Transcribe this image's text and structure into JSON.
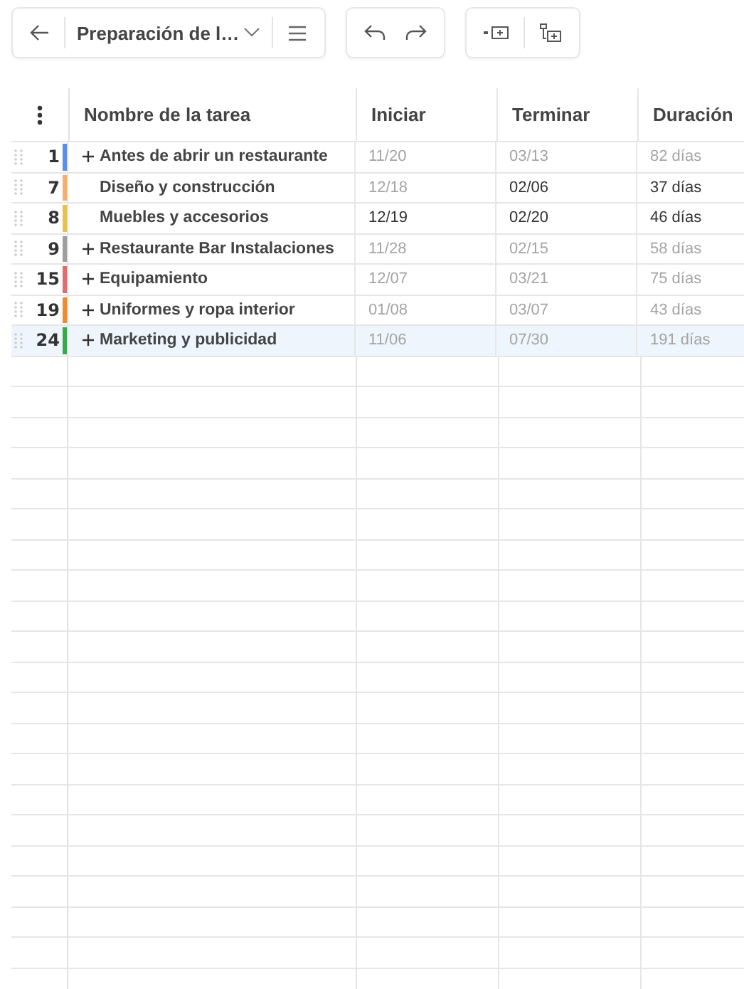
{
  "toolbar": {
    "title": "Preparación de l…"
  },
  "table": {
    "columns": [
      "Nombre de la tarea",
      "Iniciar",
      "Terminar",
      "Duración"
    ],
    "rows": [
      {
        "id": "1",
        "color": "#5b8def",
        "selected": false,
        "cells": [
          {
            "text": "Antes de abrir un restaurante",
            "expandable": true
          },
          {
            "text": "11/20",
            "muted": true
          },
          {
            "text": "03/13",
            "muted": true
          },
          {
            "text": "82 días",
            "muted": true
          }
        ]
      },
      {
        "id": "7",
        "color": "#f0b070",
        "selected": false,
        "cells": [
          {
            "text": "Diseño y construcción",
            "expandable": false
          },
          {
            "text": "12/18",
            "muted": true
          },
          {
            "text": "02/06",
            "muted": false
          },
          {
            "text": "37 días",
            "muted": false
          }
        ]
      },
      {
        "id": "8",
        "color": "#e8c050",
        "selected": false,
        "cells": [
          {
            "text": "Muebles y accesorios",
            "expandable": false
          },
          {
            "text": "12/19",
            "muted": false
          },
          {
            "text": "02/20",
            "muted": false
          },
          {
            "text": "46 días",
            "muted": false
          }
        ]
      },
      {
        "id": "9",
        "color": "#9e9e9e",
        "selected": false,
        "cells": [
          {
            "text": "Restaurante Bar Instalaciones",
            "expandable": true
          },
          {
            "text": "11/28",
            "muted": true
          },
          {
            "text": "02/15",
            "muted": true
          },
          {
            "text": "58 días",
            "muted": true
          }
        ]
      },
      {
        "id": "15",
        "color": "#e06c6c",
        "selected": false,
        "cells": [
          {
            "text": "Equipamiento",
            "expandable": true
          },
          {
            "text": "12/07",
            "muted": true
          },
          {
            "text": "03/21",
            "muted": true
          },
          {
            "text": "75 días",
            "muted": true
          }
        ]
      },
      {
        "id": "19",
        "color": "#f08a30",
        "selected": false,
        "cells": [
          {
            "text": "Uniformes y ropa interior",
            "expandable": true
          },
          {
            "text": "01/08",
            "muted": true
          },
          {
            "text": "03/07",
            "muted": true
          },
          {
            "text": "43 días",
            "muted": true
          }
        ]
      },
      {
        "id": "24",
        "color": "#3aa84a",
        "selected": true,
        "cells": [
          {
            "text": "Marketing y publicidad",
            "expandable": true
          },
          {
            "text": "11/06",
            "muted": true
          },
          {
            "text": "07/30",
            "muted": true
          },
          {
            "text": "191 días",
            "muted": true
          }
        ]
      }
    ]
  }
}
